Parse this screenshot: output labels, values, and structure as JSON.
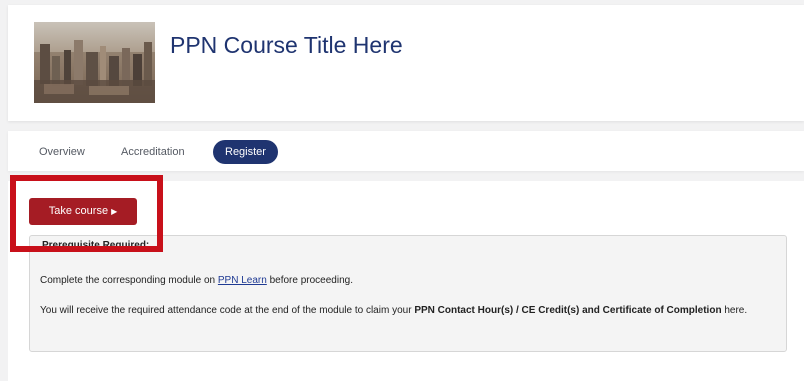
{
  "course": {
    "title": "PPN Course Title Here"
  },
  "tabs": [
    {
      "label": "Overview",
      "active": false
    },
    {
      "label": "Accreditation",
      "active": false
    },
    {
      "label": "Register",
      "active": true
    }
  ],
  "actions": {
    "take_course_label": "Take course",
    "arrow_icon": "caret-right-icon"
  },
  "prerequisite": {
    "heading": "Prerequisite Required:",
    "line1_before": "Complete the corresponding module on ",
    "line1_link": "PPN Learn",
    "line1_after": " before proceeding.",
    "line2_before": "You will receive the required attendance code at the end of the module to claim your ",
    "line2_bold": "PPN Contact Hour(s) / CE Credit(s) and Certificate of Completion",
    "line2_after": " here."
  },
  "colors": {
    "brand_navy": "#1f3470",
    "button_red": "#a51c24",
    "highlight_red": "#c8101a"
  }
}
